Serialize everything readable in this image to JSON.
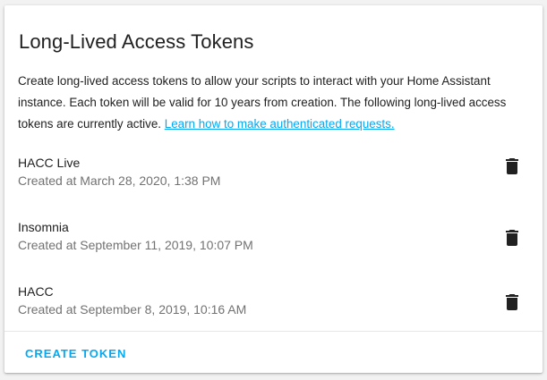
{
  "card": {
    "title": "Long-Lived Access Tokens",
    "description": "Create long-lived access tokens to allow your scripts to interact with your Home Assistant instance. Each token will be valid for 10 years from creation. The following long-lived access tokens are currently active.",
    "learn_link": "Learn how to make authenticated requests."
  },
  "tokens": [
    {
      "name": "HACC Live",
      "created": "Created at March 28, 2020, 1:38 PM",
      "icon": "delete-icon"
    },
    {
      "name": "Insomnia",
      "created": "Created at September 11, 2019, 10:07 PM",
      "icon": "delete-icon"
    },
    {
      "name": "HACC",
      "created": "Created at September 8, 2019, 10:16 AM",
      "icon": "delete-icon"
    }
  ],
  "actions": {
    "create_label": "CREATE TOKEN"
  },
  "colors": {
    "accent": "#03a9f4",
    "primary_text": "#212121",
    "secondary_text": "#727272"
  }
}
